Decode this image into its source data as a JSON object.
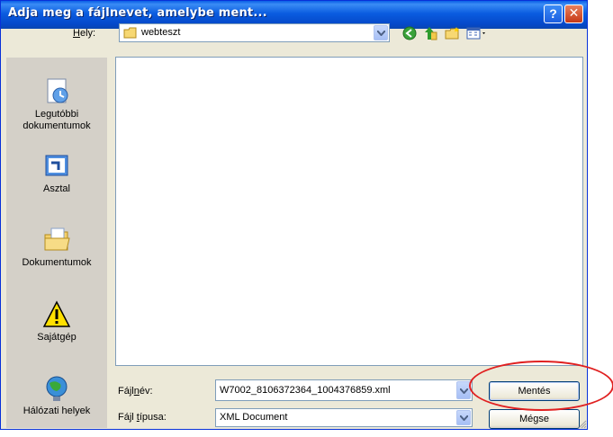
{
  "window": {
    "title": "Adja meg a fájlnevet, amelybe ment..."
  },
  "titlebar": {
    "help_label": "?",
    "close_label": "✕"
  },
  "location": {
    "label": "Hely:",
    "value": "webteszt"
  },
  "places": [
    {
      "label": "Legutóbbi dokumentumok",
      "icon": "recent-documents-icon"
    },
    {
      "label": "Asztal",
      "icon": "desktop-icon"
    },
    {
      "label": "Dokumentumok",
      "icon": "my-documents-icon"
    },
    {
      "label": "Sajátgép",
      "icon": "warning-icon"
    },
    {
      "label": "Hálózati helyek",
      "icon": "network-places-icon"
    }
  ],
  "toolbar": [
    "back-icon",
    "up-folder-icon",
    "new-folder-icon",
    "views-menu-icon"
  ],
  "filename": {
    "label": "Fájlnév:",
    "value": "W7002_8106372364_1004376859.xml"
  },
  "filetype": {
    "label": "Fájl típusa:",
    "value": "XML Document"
  },
  "buttons": {
    "save": "Mentés",
    "cancel": "Mégse"
  },
  "colors": {
    "titlebar": "#0a5ce0",
    "dialog": "#ece9d8",
    "highlight_circle": "#e02020"
  }
}
